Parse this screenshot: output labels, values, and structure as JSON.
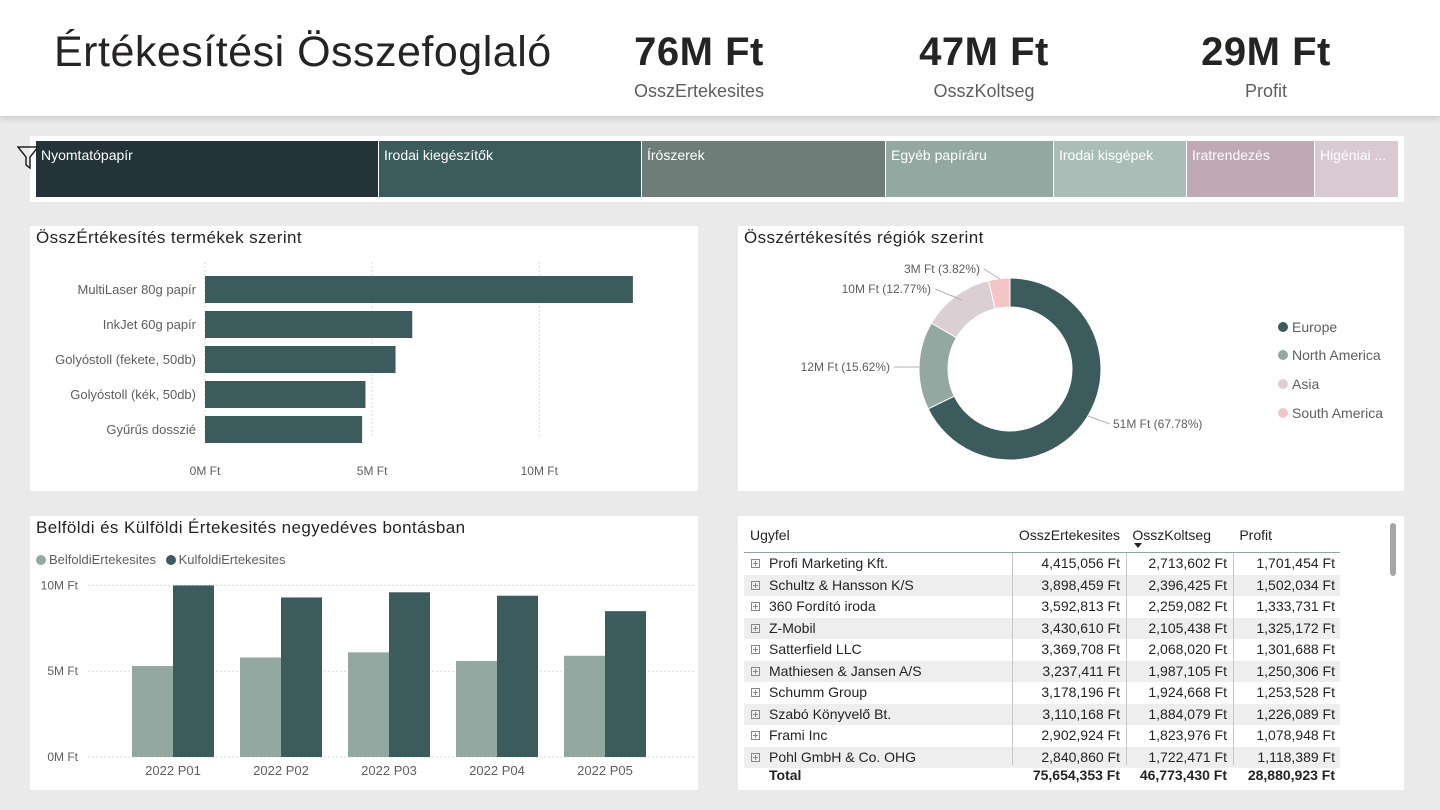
{
  "header": {
    "title": "Értékesítési Összefoglaló",
    "kpis": [
      {
        "value": "76M Ft",
        "label": "OsszErtekesites"
      },
      {
        "value": "47M Ft",
        "label": "OsszKoltseg"
      },
      {
        "value": "29M Ft",
        "label": "Profit"
      }
    ]
  },
  "treemap": {
    "tiles": [
      {
        "label": "Nyomtatópapír",
        "color": "#243337"
      },
      {
        "label": "Irodai kiegészítők",
        "color": "#3b5b5c"
      },
      {
        "label": "Írószerek",
        "color": "#6e7d78"
      },
      {
        "label": "Egyéb papíráru",
        "color": "#93a8a0"
      },
      {
        "label": "Irodai kisgépek",
        "color": "#abbdb7"
      },
      {
        "label": "Iratrendezés",
        "color": "#bfa9b2"
      },
      {
        "label": "Higéniai ...",
        "color": "#d8cad0"
      }
    ]
  },
  "colors": {
    "dark": "#3b5b5c",
    "light": "#93a8a0",
    "pink_light": "#dccfd3",
    "pink": "#f3c5c5"
  },
  "chart_data": [
    {
      "type": "bar",
      "title": "ÖsszÉrtékesítés termékek szerint",
      "orientation": "horizontal",
      "categories": [
        "MultiLaser 80g papír",
        "InkJet 60g papír",
        "Golyóstoll (fekete, 50db)",
        "Golyóstoll (kék, 50db)",
        "Gyűrűs dosszié"
      ],
      "values": [
        12.8,
        6.2,
        5.7,
        4.8,
        4.7
      ],
      "unit": "M Ft",
      "xlim": [
        0,
        14
      ],
      "xticks": [
        "0M Ft",
        "5M Ft",
        "10M Ft"
      ],
      "xtick_values": [
        0,
        5,
        10
      ],
      "color": "#3b5b5c",
      "grid": true
    },
    {
      "type": "pie",
      "donut": true,
      "title": "Összértékesítés régiók szerint",
      "categories": [
        "Europe",
        "North America",
        "Asia",
        "South America"
      ],
      "values": [
        67.78,
        15.62,
        12.77,
        3.82
      ],
      "labels": [
        "51M Ft (67.78%)",
        "12M Ft (15.62%)",
        "10M Ft (12.77%)",
        "3M Ft (3.82%)"
      ],
      "colors": [
        "#3b5b5c",
        "#93a8a0",
        "#dccfd3",
        "#f3c5c5"
      ],
      "legend": "right"
    },
    {
      "type": "bar",
      "title": "Belföldi és Külföldi Értekesités negyedéves bontásban",
      "categories": [
        "2022 P01",
        "2022 P02",
        "2022 P03",
        "2022 P04",
        "2022 P05"
      ],
      "series": [
        {
          "name": "BelfoldiErtekesites",
          "values": [
            5.3,
            5.8,
            6.1,
            5.6,
            5.9
          ],
          "color": "#93a8a0"
        },
        {
          "name": "KulfoldiErtekesites",
          "values": [
            10.0,
            9.3,
            9.6,
            9.4,
            8.5
          ],
          "color": "#3b5b5c"
        }
      ],
      "unit": "M Ft",
      "ylim": [
        0,
        10.2
      ],
      "yticks": [
        "0M Ft",
        "5M Ft",
        "10M Ft"
      ],
      "ytick_values": [
        0,
        5,
        10
      ],
      "legend": "top-left",
      "grid": true
    }
  ],
  "table": {
    "columns": [
      "Ugyfel",
      "OsszErtekesites",
      "OsszKoltseg",
      "Profit"
    ],
    "rows": [
      [
        "Profi Marketing Kft.",
        "4,415,056 Ft",
        "2,713,602 Ft",
        "1,701,454 Ft"
      ],
      [
        "Schultz & Hansson K/S",
        "3,898,459 Ft",
        "2,396,425 Ft",
        "1,502,034 Ft"
      ],
      [
        "360 Fordító iroda",
        "3,592,813 Ft",
        "2,259,082 Ft",
        "1,333,731 Ft"
      ],
      [
        "Z-Mobil",
        "3,430,610 Ft",
        "2,105,438 Ft",
        "1,325,172 Ft"
      ],
      [
        "Satterfield LLC",
        "3,369,708 Ft",
        "2,068,020 Ft",
        "1,301,688 Ft"
      ],
      [
        "Mathiesen & Jansen A/S",
        "3,237,411 Ft",
        "1,987,105 Ft",
        "1,250,306 Ft"
      ],
      [
        "Schumm Group",
        "3,178,196 Ft",
        "1,924,668 Ft",
        "1,253,528 Ft"
      ],
      [
        "Szabó Könyvelő Bt.",
        "3,110,168 Ft",
        "1,884,079 Ft",
        "1,226,089 Ft"
      ],
      [
        "Frami Inc",
        "2,902,924 Ft",
        "1,823,976 Ft",
        "1,078,948 Ft"
      ],
      [
        "Pohl GmbH & Co. OHG",
        "2,840,860 Ft",
        "1,722,471 Ft",
        "1,118,389 Ft"
      ]
    ],
    "total": [
      "Total",
      "75,654,353 Ft",
      "46,773,430 Ft",
      "28,880,923 Ft"
    ]
  }
}
